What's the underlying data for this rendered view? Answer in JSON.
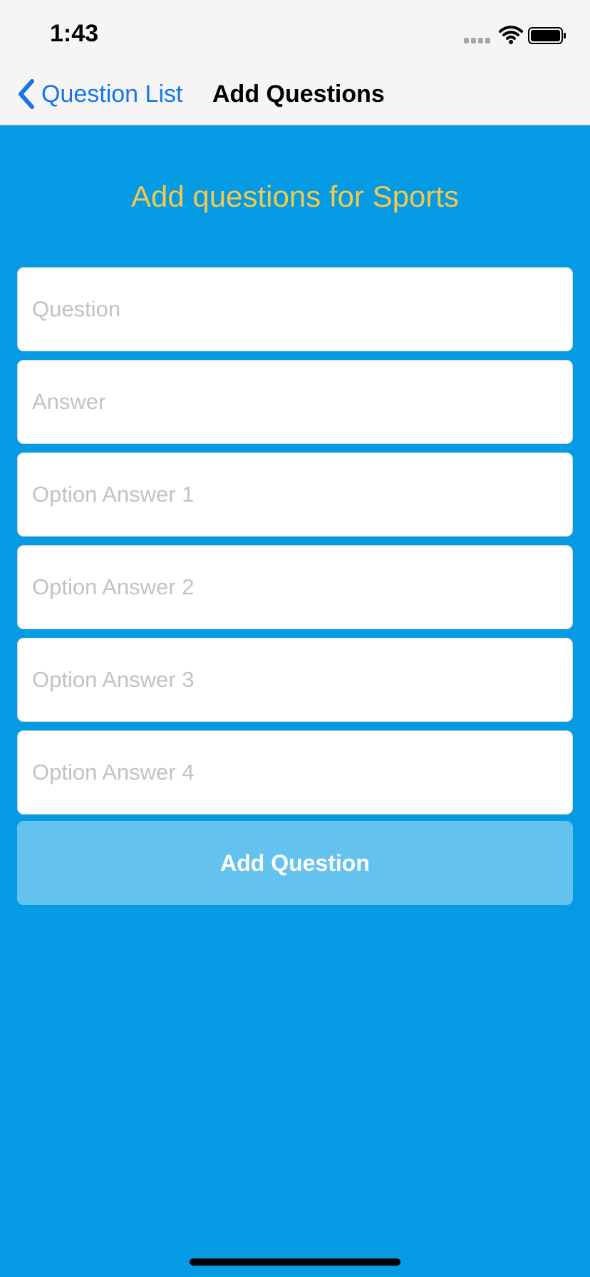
{
  "status_bar": {
    "time": "1:43",
    "signal_icon": "cellular-signal-icon",
    "wifi_icon": "wifi-icon",
    "battery_icon": "battery-icon"
  },
  "nav_bar": {
    "back_label": "Question List",
    "back_icon": "chevron-left-icon",
    "title": "Add Questions",
    "back_color": "#1675e8"
  },
  "page": {
    "heading": "Add questions for Sports",
    "background_color": "#049be4",
    "heading_color": "#f4c84a"
  },
  "form": {
    "question": {
      "value": "",
      "placeholder": "Question"
    },
    "answer": {
      "value": "",
      "placeholder": "Answer"
    },
    "option_1": {
      "value": "",
      "placeholder": "Option Answer 1"
    },
    "option_2": {
      "value": "",
      "placeholder": "Option Answer 2"
    },
    "option_3": {
      "value": "",
      "placeholder": "Option Answer 3"
    },
    "option_4": {
      "value": "",
      "placeholder": "Option Answer 4"
    },
    "submit_label": "Add Question",
    "submit_color": "#64c3ee"
  }
}
